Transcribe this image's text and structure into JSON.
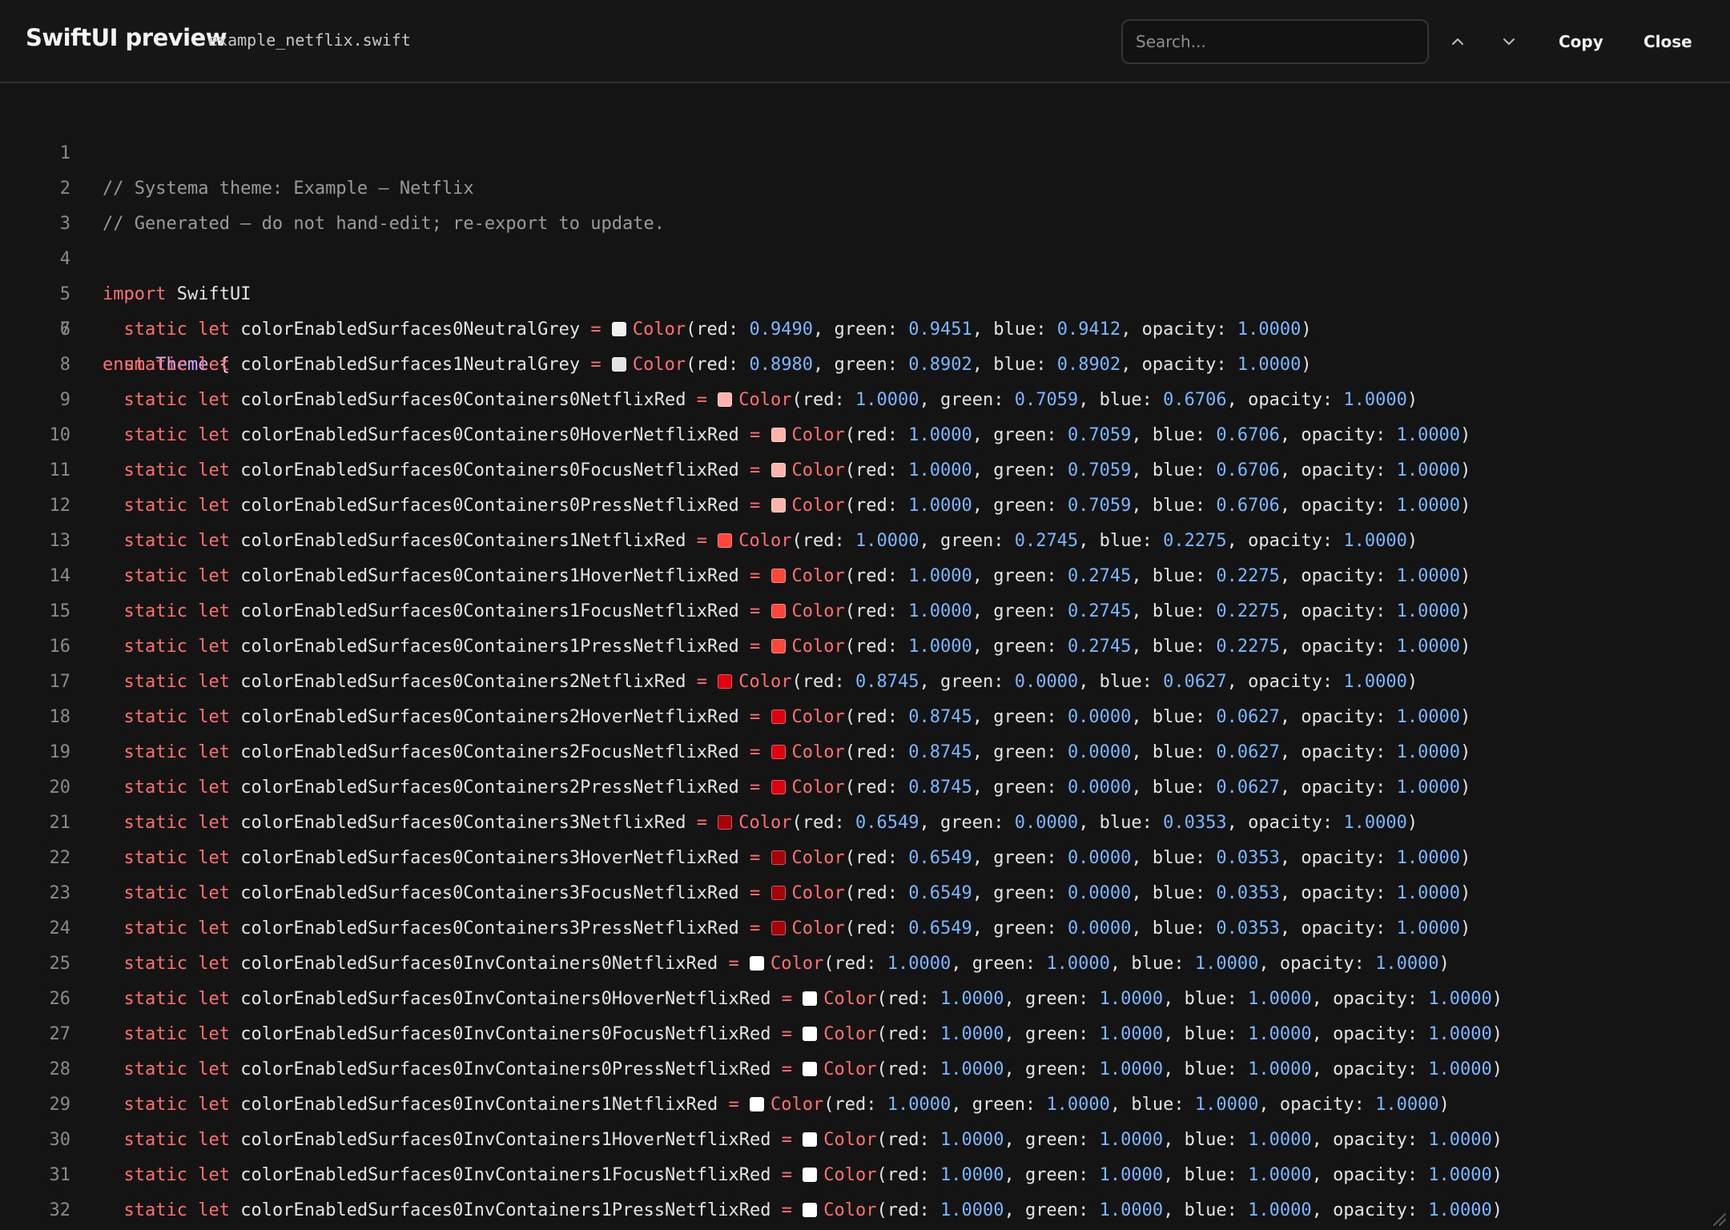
{
  "header": {
    "title": "SwiftUI preview",
    "filename": "example_netflix.swift",
    "search_placeholder": "Search...",
    "copy_label": "Copy",
    "close_label": "Close"
  },
  "code": {
    "comment_lines": [
      "// Systema theme: Example — Netflix",
      "// Generated — do not hand-edit; re-export to update."
    ],
    "import_keyword": "import",
    "import_module": "SwiftUI",
    "enum_keyword": "enum",
    "enum_name": "Theme",
    "open_brace": "{",
    "tokens": {
      "static": "static",
      "let": "let",
      "color": "Color"
    },
    "decls": [
      {
        "name": "colorEnabledSurfaces0NeutralGrey",
        "swatch": "#f2f1f0",
        "r": "0.9490",
        "g": "0.9451",
        "b": "0.9412",
        "o": "1.0000"
      },
      {
        "name": "colorEnabledSurfaces1NeutralGrey",
        "swatch": "#e5e3e3",
        "r": "0.8980",
        "g": "0.8902",
        "b": "0.8902",
        "o": "1.0000"
      },
      {
        "name": "colorEnabledSurfaces0Containers0NetflixRed",
        "swatch": "#ffb4ab",
        "r": "1.0000",
        "g": "0.7059",
        "b": "0.6706",
        "o": "1.0000"
      },
      {
        "name": "colorEnabledSurfaces0Containers0HoverNetflixRed",
        "swatch": "#ffb4ab",
        "r": "1.0000",
        "g": "0.7059",
        "b": "0.6706",
        "o": "1.0000"
      },
      {
        "name": "colorEnabledSurfaces0Containers0FocusNetflixRed",
        "swatch": "#ffb4ab",
        "r": "1.0000",
        "g": "0.7059",
        "b": "0.6706",
        "o": "1.0000"
      },
      {
        "name": "colorEnabledSurfaces0Containers0PressNetflixRed",
        "swatch": "#ffb4ab",
        "r": "1.0000",
        "g": "0.7059",
        "b": "0.6706",
        "o": "1.0000"
      },
      {
        "name": "colorEnabledSurfaces0Containers1NetflixRed",
        "swatch": "#ff463a",
        "r": "1.0000",
        "g": "0.2745",
        "b": "0.2275",
        "o": "1.0000"
      },
      {
        "name": "colorEnabledSurfaces0Containers1HoverNetflixRed",
        "swatch": "#ff463a",
        "r": "1.0000",
        "g": "0.2745",
        "b": "0.2275",
        "o": "1.0000"
      },
      {
        "name": "colorEnabledSurfaces0Containers1FocusNetflixRed",
        "swatch": "#ff463a",
        "r": "1.0000",
        "g": "0.2745",
        "b": "0.2275",
        "o": "1.0000"
      },
      {
        "name": "colorEnabledSurfaces0Containers1PressNetflixRed",
        "swatch": "#ff463a",
        "r": "1.0000",
        "g": "0.2745",
        "b": "0.2275",
        "o": "1.0000"
      },
      {
        "name": "colorEnabledSurfaces0Containers2NetflixRed",
        "swatch": "#df0010",
        "r": "0.8745",
        "g": "0.0000",
        "b": "0.0627",
        "o": "1.0000"
      },
      {
        "name": "colorEnabledSurfaces0Containers2HoverNetflixRed",
        "swatch": "#df0010",
        "r": "0.8745",
        "g": "0.0000",
        "b": "0.0627",
        "o": "1.0000"
      },
      {
        "name": "colorEnabledSurfaces0Containers2FocusNetflixRed",
        "swatch": "#df0010",
        "r": "0.8745",
        "g": "0.0000",
        "b": "0.0627",
        "o": "1.0000"
      },
      {
        "name": "colorEnabledSurfaces0Containers2PressNetflixRed",
        "swatch": "#df0010",
        "r": "0.8745",
        "g": "0.0000",
        "b": "0.0627",
        "o": "1.0000"
      },
      {
        "name": "colorEnabledSurfaces0Containers3NetflixRed",
        "swatch": "#a70009",
        "r": "0.6549",
        "g": "0.0000",
        "b": "0.0353",
        "o": "1.0000"
      },
      {
        "name": "colorEnabledSurfaces0Containers3HoverNetflixRed",
        "swatch": "#a70009",
        "r": "0.6549",
        "g": "0.0000",
        "b": "0.0353",
        "o": "1.0000"
      },
      {
        "name": "colorEnabledSurfaces0Containers3FocusNetflixRed",
        "swatch": "#a70009",
        "r": "0.6549",
        "g": "0.0000",
        "b": "0.0353",
        "o": "1.0000"
      },
      {
        "name": "colorEnabledSurfaces0Containers3PressNetflixRed",
        "swatch": "#a70009",
        "r": "0.6549",
        "g": "0.0000",
        "b": "0.0353",
        "o": "1.0000"
      },
      {
        "name": "colorEnabledSurfaces0InvContainers0NetflixRed",
        "swatch": "#ffffff",
        "r": "1.0000",
        "g": "1.0000",
        "b": "1.0000",
        "o": "1.0000"
      },
      {
        "name": "colorEnabledSurfaces0InvContainers0HoverNetflixRed",
        "swatch": "#ffffff",
        "r": "1.0000",
        "g": "1.0000",
        "b": "1.0000",
        "o": "1.0000"
      },
      {
        "name": "colorEnabledSurfaces0InvContainers0FocusNetflixRed",
        "swatch": "#ffffff",
        "r": "1.0000",
        "g": "1.0000",
        "b": "1.0000",
        "o": "1.0000"
      },
      {
        "name": "colorEnabledSurfaces0InvContainers0PressNetflixRed",
        "swatch": "#ffffff",
        "r": "1.0000",
        "g": "1.0000",
        "b": "1.0000",
        "o": "1.0000"
      },
      {
        "name": "colorEnabledSurfaces0InvContainers1NetflixRed",
        "swatch": "#ffffff",
        "r": "1.0000",
        "g": "1.0000",
        "b": "1.0000",
        "o": "1.0000"
      },
      {
        "name": "colorEnabledSurfaces0InvContainers1HoverNetflixRed",
        "swatch": "#ffffff",
        "r": "1.0000",
        "g": "1.0000",
        "b": "1.0000",
        "o": "1.0000"
      },
      {
        "name": "colorEnabledSurfaces0InvContainers1FocusNetflixRed",
        "swatch": "#ffffff",
        "r": "1.0000",
        "g": "1.0000",
        "b": "1.0000",
        "o": "1.0000"
      },
      {
        "name": "colorEnabledSurfaces0InvContainers1PressNetflixRed",
        "swatch": "#ffffff",
        "r": "1.0000",
        "g": "1.0000",
        "b": "1.0000",
        "o": "1.0000"
      }
    ]
  },
  "icons": {
    "prev": "chevron-up-icon",
    "next": "chevron-down-icon",
    "resize": "resize-grip-icon"
  },
  "colors": {
    "background": "#141414",
    "keyword": "#ff6f6f",
    "type_name": "#d6a8ff",
    "number": "#79b8ff",
    "comment": "#9a9a9a"
  }
}
